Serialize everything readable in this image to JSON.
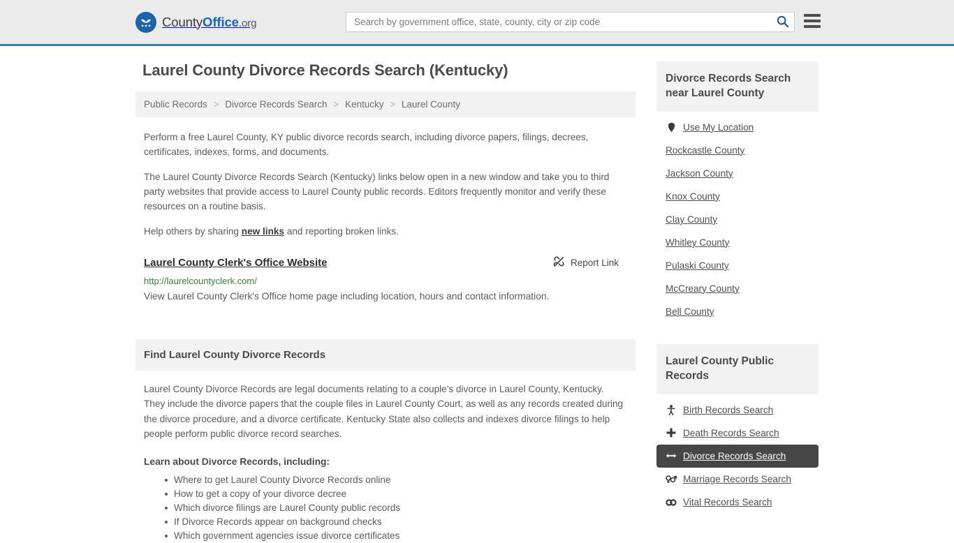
{
  "header": {
    "brand_prefix": "County",
    "brand_bold": "Office",
    "brand_tld": ".org",
    "logo_icon": "eagle-stars-icon",
    "search_placeholder": "Search by government office, state, county, city or zip code",
    "search_value": "",
    "search_icon": "search-icon",
    "menu_icon": "hamburger-menu-icon",
    "accent_color": "#3a7ca8",
    "background_color": "#ecebeb"
  },
  "main": {
    "title": "Laurel County Divorce Records Search (Kentucky)",
    "breadcrumb": [
      "Public Records",
      "Divorce Records Search",
      "Kentucky",
      "Laurel County"
    ],
    "breadcrumb_separator": ">",
    "intro_paragraph": "Perform a free Laurel County, KY public divorce records search, including divorce papers, filings, decrees, certificates, indexes, forms, and documents.",
    "second_paragraph": "The Laurel County Divorce Records Search (Kentucky) links below open in a new window and take you to third party websites that provide access to Laurel County public records. Editors frequently monitor and verify these resources on a routine basis.",
    "help_prefix": "Help others by sharing ",
    "help_link": "new links",
    "help_suffix": " and reporting broken links.",
    "result": {
      "title": "Laurel County Clerk's Office Website",
      "url": "http://laurelcountyclerk.com/",
      "description": "View Laurel County Clerk's Office home page including location, hours and contact information.",
      "report_label": "Report Link",
      "report_icon": "broken-link-icon"
    },
    "find_section": {
      "heading": "Find Laurel County Divorce Records",
      "paragraph": "Laurel County Divorce Records are legal documents relating to a couple's divorce in Laurel County, Kentucky. They include the divorce papers that the couple files in Laurel County Court, as well as any records created during the divorce procedure, and a divorce certificate. Kentucky State also collects and indexes divorce filings to help people perform public divorce record searches.",
      "learn_label": "Learn about Divorce Records, including:",
      "learn_items": [
        "Where to get Laurel County Divorce Records online",
        "How to get a copy of your divorce decree",
        "Which divorce filings are Laurel County public records",
        "If Divorce Records appear on background checks",
        "Which government agencies issue divorce certificates"
      ]
    }
  },
  "sidebar": {
    "nearby": {
      "heading": "Divorce Records Search near Laurel County",
      "use_my_location": {
        "label": "Use My Location",
        "icon": "map-pin-icon"
      },
      "counties": [
        "Rockcastle County",
        "Jackson County",
        "Knox County",
        "Clay County",
        "Whitley County",
        "Pulaski County",
        "McCreary County",
        "Bell County"
      ]
    },
    "public_records": {
      "heading": "Laurel County Public Records",
      "active_label": "Divorce Records Search",
      "active_background": "#464646",
      "items": [
        {
          "label": "Birth Records Search",
          "icon": "baby-icon",
          "active": false
        },
        {
          "label": "Death Records Search",
          "icon": "cross-icon",
          "active": false
        },
        {
          "label": "Divorce Records Search",
          "icon": "left-right-arrow-icon",
          "active": true
        },
        {
          "label": "Marriage Records Search",
          "icon": "venus-mars-icon",
          "active": false
        },
        {
          "label": "Vital Records Search",
          "icon": "rings-icon",
          "active": false
        }
      ]
    }
  }
}
